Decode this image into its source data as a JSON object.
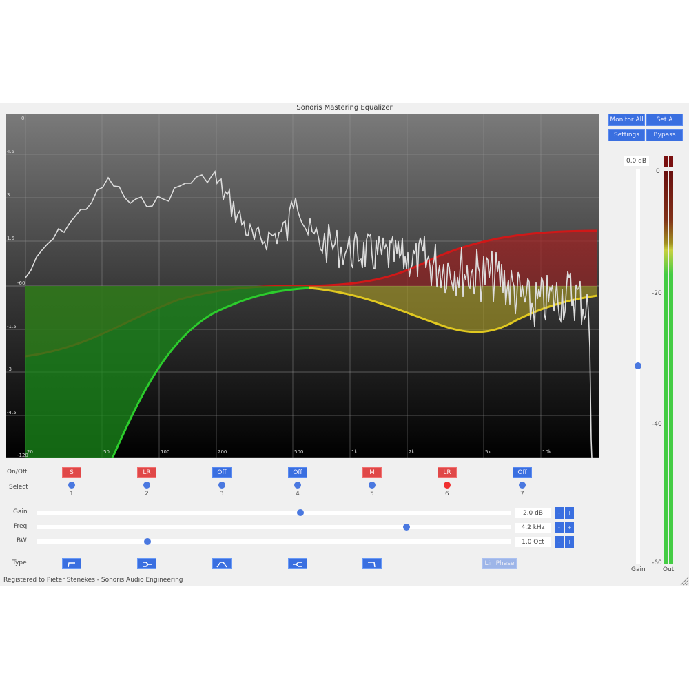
{
  "app": {
    "title": "Sonoris Mastering Equalizer",
    "footer": "Registered to Pieter Stenekes - Sonoris Audio Engineering"
  },
  "top_buttons": {
    "monitor_all": "Monitor All",
    "set_a": "Set A",
    "settings": "Settings",
    "bypass": "Bypass"
  },
  "graph": {
    "y_labels": [
      "0",
      "4.5",
      "3",
      "1.5",
      "-60",
      "-1.5",
      "-3",
      "-4.5",
      "-120"
    ],
    "x_labels": [
      "20",
      "50",
      "100",
      "200",
      "500",
      "1k",
      "2k",
      "5k",
      "10k"
    ],
    "colors": {
      "band_red": "#cc1a1a",
      "band_green": "#22bb22",
      "band_yellow": "#d8c020",
      "spectrum": "#d8d8d8"
    }
  },
  "bands": {
    "row_labels": {
      "onoff": "On/Off",
      "select": "Select",
      "gain": "Gain",
      "freq": "Freq",
      "bw": "BW",
      "type": "Type"
    },
    "items": [
      {
        "num": "1",
        "state": "S",
        "active": true,
        "selected": false,
        "type": "low-cut-icon"
      },
      {
        "num": "2",
        "state": "LR",
        "active": true,
        "selected": false,
        "type": "low-shelf-icon"
      },
      {
        "num": "3",
        "state": "Off",
        "active": false,
        "selected": false,
        "type": "bell-icon"
      },
      {
        "num": "4",
        "state": "Off",
        "active": false,
        "selected": false,
        "type": "notch-icon"
      },
      {
        "num": "5",
        "state": "M",
        "active": true,
        "selected": false,
        "type": "high-cut-icon"
      },
      {
        "num": "6",
        "state": "LR",
        "active": true,
        "selected": true
      },
      {
        "num": "7",
        "state": "Off",
        "active": false,
        "selected": false
      }
    ],
    "gain": {
      "value": "2.0 dB",
      "position": 0.56
    },
    "freq": {
      "value": "4.2 kHz",
      "position": 0.78
    },
    "bw": {
      "value": "1.0 Oct",
      "position": 0.23
    },
    "minus": "-",
    "plus": "+",
    "lin_phase": "Lin Phase"
  },
  "output": {
    "gain_value": "0.0 dB",
    "gain_label": "Gain",
    "out_label": "Out",
    "meter_labels": [
      "0",
      "-20",
      "-40",
      "-60"
    ],
    "gain_position": 0.5
  }
}
